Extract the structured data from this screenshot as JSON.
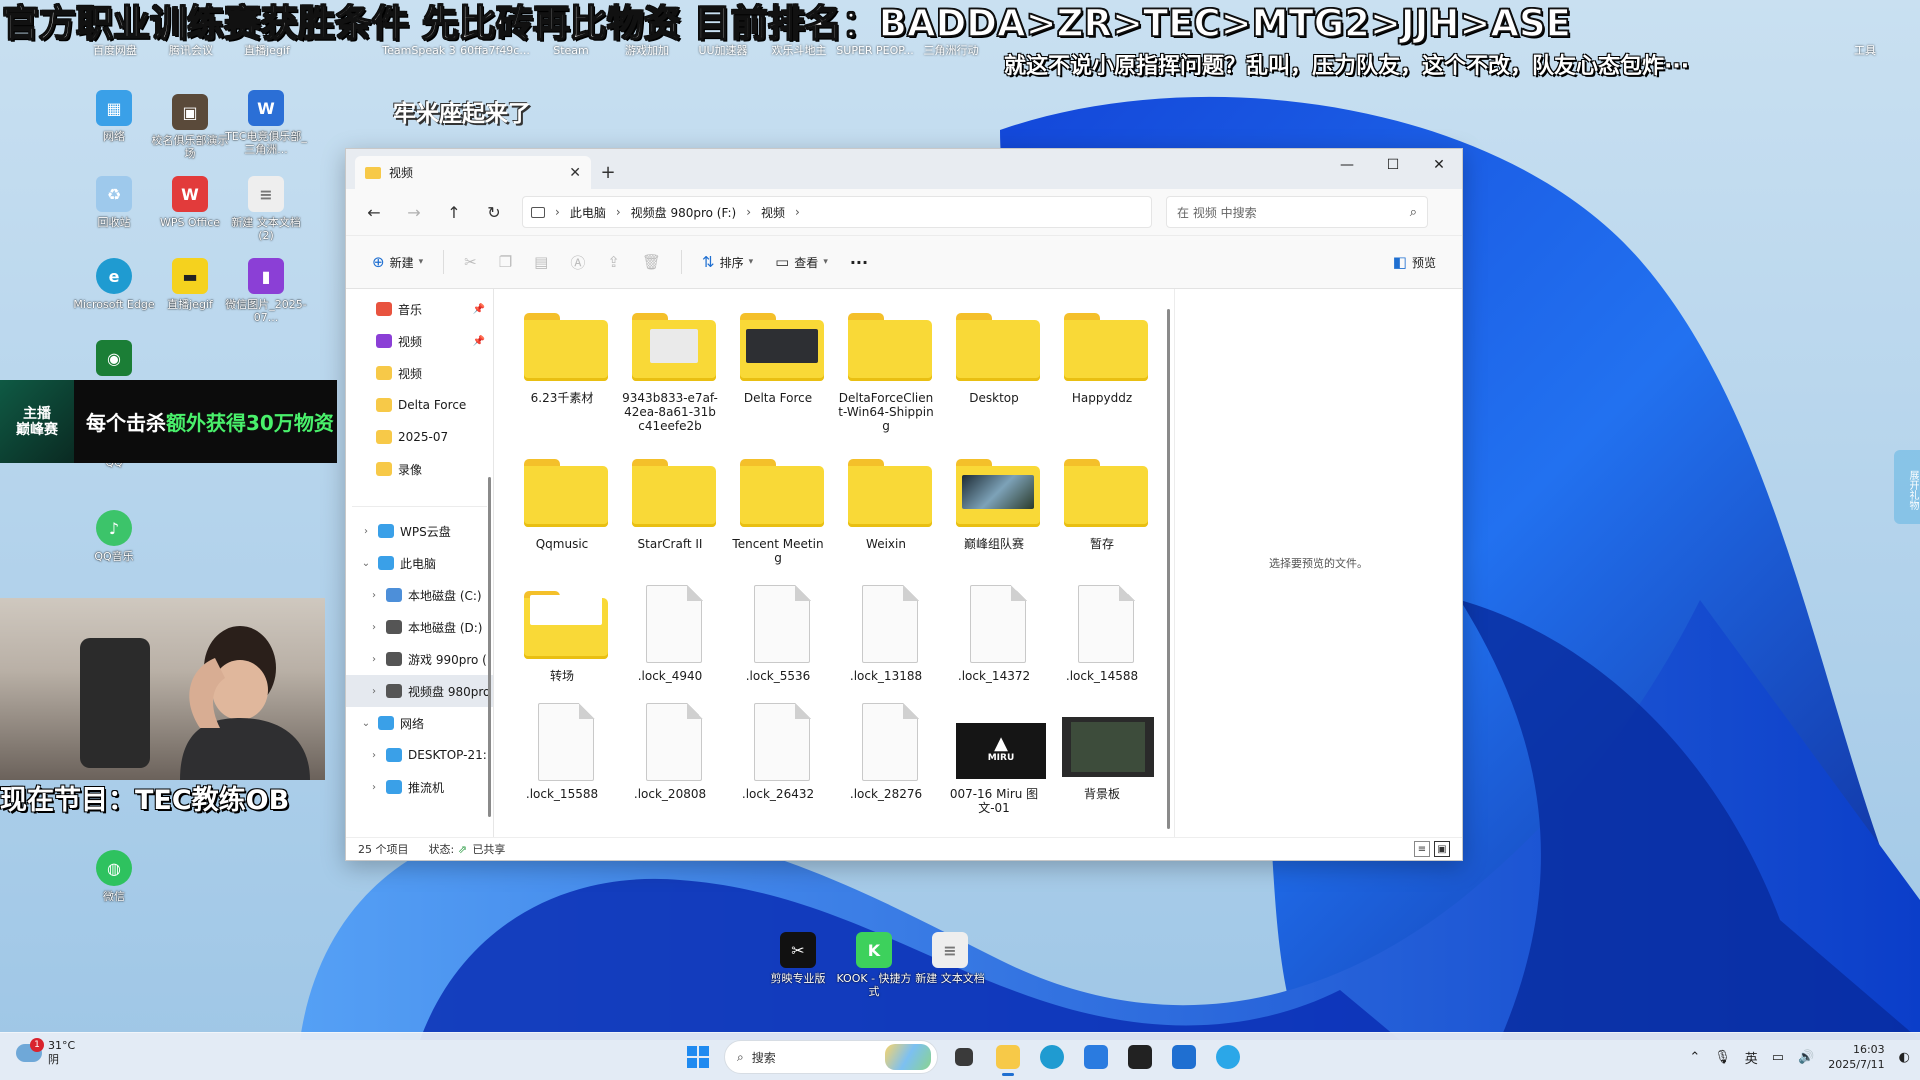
{
  "overlays": {
    "title": "官方职业训练赛获胜条件 先比砖再比物资 目前排名：BADDA>ZR>TEC>MTG2>JJH>ASE",
    "subtitle": "就这不说小原指挥问题？乱叫，压力队友，这个不改，队友心态包炸···",
    "comment": "牢米座起来了",
    "banner_logo": "主播\n巅峰赛",
    "banner_text_prefix": "每个击杀",
    "banner_text_highlight": "额外获得30万物资",
    "now_playing": "现在节目：TEC教练OB",
    "side_tab": "展开礼物"
  },
  "desktop": {
    "top_labels": [
      "百度网盘",
      "腾讯会议",
      "直播jegif",
      "TeamSpeak 3",
      "60ffa7f49c...",
      "Steam",
      "游戏加加",
      "UU加速器",
      "欢乐斗地主",
      "SUPER PEOP...",
      "三角洲行动",
      "工具"
    ],
    "icons": [
      {
        "label": "网络",
        "color": "#3aa0e8",
        "glyph": "▦"
      },
      {
        "label": "校名俱乐部演示场",
        "color": "#5a4a3a",
        "glyph": "▣"
      },
      {
        "label": "TEC电竞俱乐部_三角洲...",
        "color": "#2b6fd6",
        "glyph": "W"
      },
      {
        "label": "回收站",
        "color": "#9ec9ec",
        "glyph": "♻"
      },
      {
        "label": "WPS Office",
        "color": "#e23b3b",
        "glyph": "W"
      },
      {
        "label": "新建 文本文档 (2)",
        "color": "#eeeeee",
        "glyph": "≡"
      },
      {
        "label": "Microsoft Edge",
        "color": "#1f9bd1",
        "glyph": "e"
      },
      {
        "label": "直播jegif",
        "color": "#f5d21e",
        "glyph": "▬"
      },
      {
        "label": "微信图片_2025-07...",
        "color": "#8b3fd6",
        "glyph": "▮"
      },
      {
        "label": "",
        "color": "#1b7e36",
        "glyph": "◉"
      },
      {
        "label": "QQ",
        "color": "#1f9bd1",
        "glyph": "Q"
      },
      {
        "label": "QQ音乐",
        "color": "#3cc46a",
        "glyph": "♪"
      },
      {
        "label": "微信",
        "color": "#2ec25f",
        "glyph": "◍"
      }
    ],
    "bottom_icons": [
      {
        "label": "剪映专业版",
        "color": "#111111",
        "glyph": "✂"
      },
      {
        "label": "KOOK - 快捷方式",
        "color": "#3dd15c",
        "glyph": "K"
      },
      {
        "label": "新建 文本文档",
        "color": "#eeeeee",
        "glyph": "≡"
      }
    ]
  },
  "explorer": {
    "tab_title": "视频",
    "tab_close": "✕",
    "new_tab": "+",
    "window_controls": {
      "minimize": "—",
      "maximize": "☐",
      "close": "✕"
    },
    "nav": {
      "back": "←",
      "forward": "→",
      "up": "↑",
      "refresh": "↻"
    },
    "breadcrumb": [
      "此电脑",
      "视频盘 980pro (F:)",
      "视频"
    ],
    "search_placeholder": "在 视频 中搜索",
    "commands": {
      "new": "新建",
      "sort": "排序",
      "view": "查看",
      "more": "···",
      "preview": "预览"
    },
    "nav_pane": [
      {
        "label": "音乐",
        "color": "#e8533f",
        "pinned": true,
        "level": 0
      },
      {
        "label": "视频",
        "color": "#8b3fd6",
        "pinned": true,
        "level": 0
      },
      {
        "label": "视频",
        "color": "#f7c948",
        "pinned": false,
        "level": 0
      },
      {
        "label": "Delta Force",
        "color": "#f7c948",
        "pinned": false,
        "level": 0
      },
      {
        "label": "2025-07",
        "color": "#f7c948",
        "pinned": false,
        "level": 0
      },
      {
        "label": "录像",
        "color": "#f7c948",
        "pinned": false,
        "level": 0
      },
      {
        "gap": true
      },
      {
        "label": "WPS云盘",
        "color": "#3aa0e8",
        "chevron": "›",
        "level": 1
      },
      {
        "label": "此电脑",
        "color": "#3aa0e8",
        "chevron": "⌄",
        "level": 1
      },
      {
        "label": "本地磁盘 (C:)",
        "color": "#4d8fd9",
        "chevron": "›",
        "level": 2
      },
      {
        "label": "本地磁盘 (D:)",
        "color": "#555555",
        "chevron": "›",
        "level": 2
      },
      {
        "label": "游戏 990pro (",
        "color": "#555555",
        "chevron": "›",
        "level": 2
      },
      {
        "label": "视频盘 980pro",
        "color": "#555555",
        "chevron": "›",
        "level": 2,
        "selected": true
      },
      {
        "label": "网络",
        "color": "#3aa0e8",
        "chevron": "⌄",
        "level": 1
      },
      {
        "label": "DESKTOP-21:",
        "color": "#3aa0e8",
        "chevron": "›",
        "level": 2
      },
      {
        "label": "推流机",
        "color": "#3aa0e8",
        "chevron": "›",
        "level": 2
      }
    ],
    "items": [
      {
        "name": "6.23千素材",
        "kind": "folder"
      },
      {
        "name": "9343b833-e7af-42ea-8a61-31bc41eefe2b",
        "kind": "folder-doc"
      },
      {
        "name": "Delta Force",
        "kind": "folder-dark"
      },
      {
        "name": "DeltaForceClient-Win64-Shipping",
        "kind": "folder"
      },
      {
        "name": "Desktop",
        "kind": "folder"
      },
      {
        "name": "Happyddz",
        "kind": "folder"
      },
      {
        "name": "Qqmusic",
        "kind": "folder"
      },
      {
        "name": "StarCraft II",
        "kind": "folder"
      },
      {
        "name": "Tencent Meeting",
        "kind": "folder"
      },
      {
        "name": "Weixin",
        "kind": "folder"
      },
      {
        "name": "巅峰组队赛",
        "kind": "folder-img"
      },
      {
        "name": "暂存",
        "kind": "folder"
      },
      {
        "name": "转场",
        "kind": "folder-open"
      },
      {
        "name": ".lock_4940",
        "kind": "file"
      },
      {
        "name": ".lock_5536",
        "kind": "file"
      },
      {
        "name": ".lock_13188",
        "kind": "file"
      },
      {
        "name": ".lock_14372",
        "kind": "file"
      },
      {
        "name": ".lock_14588",
        "kind": "file"
      },
      {
        "name": ".lock_15588",
        "kind": "file"
      },
      {
        "name": ".lock_20808",
        "kind": "file"
      },
      {
        "name": ".lock_26432",
        "kind": "file"
      },
      {
        "name": ".lock_28276",
        "kind": "file"
      },
      {
        "name": "007-16 Miru 图文-01",
        "kind": "image",
        "thumb_text": "MIRU"
      },
      {
        "name": "背景板",
        "kind": "video"
      }
    ],
    "preview_text": "选择要预览的文件。",
    "status_count": "25 个项目",
    "status_state_label": "状态:",
    "status_state_value": "已共享"
  },
  "taskbar": {
    "weather_temp": "31°C",
    "weather_desc": "阴",
    "weather_badge": "1",
    "search_label": "搜索",
    "ime": "英",
    "time": "16:03",
    "date": "2025/7/11"
  },
  "colors": {
    "folder": "#f9d937",
    "accent": "#1f6fd1",
    "highlight_green": "#49f06b"
  }
}
